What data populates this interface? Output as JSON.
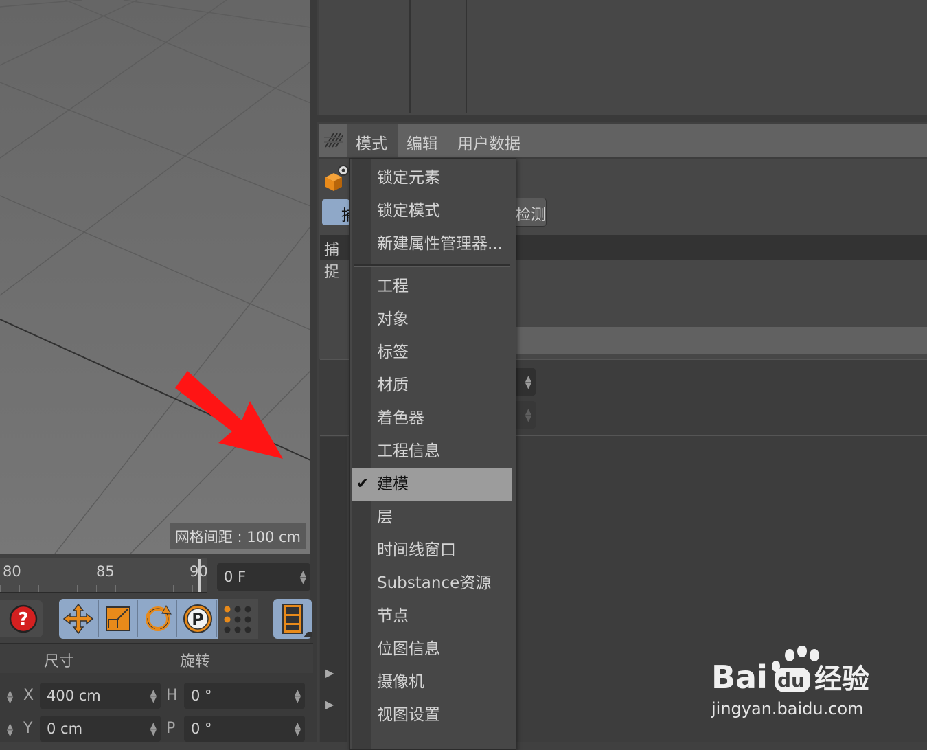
{
  "viewport": {
    "grid_label": "网格间距 : 100 cm"
  },
  "timeline": {
    "ticks": [
      "80",
      "85",
      "90"
    ],
    "frame_value": "0 F"
  },
  "coordinates": {
    "col_size": "尺寸",
    "col_rotation": "旋转",
    "rows": [
      {
        "axis": "X",
        "size": "400 cm",
        "rot_axis": "H",
        "rot": "0 °"
      },
      {
        "axis": "Y",
        "size": "0 cm",
        "rot_axis": "P",
        "rot": "0 °"
      }
    ]
  },
  "attribute_manager": {
    "menu": [
      "模式",
      "编辑",
      "用户数据"
    ],
    "partial_tab": "捕",
    "partial_label": "捕捉",
    "partial_button": "检测"
  },
  "dropdown": {
    "items_top": [
      "锁定元素",
      "锁定模式",
      "新建属性管理器..."
    ],
    "items": [
      "工程",
      "对象",
      "标签",
      "材质",
      "着色器",
      "工程信息",
      "建模",
      "层",
      "时间线窗口",
      "Substance资源",
      "节点",
      "位图信息",
      "摄像机",
      "视图设置"
    ],
    "selected": "建模",
    "check_mark": "✔"
  },
  "watermark": {
    "logo_text": "Bai",
    "logo_du": "du",
    "logo_cn": "经验",
    "url": "jingyan.baidu.com"
  },
  "colors": {
    "accent_blue": "#8fa8c8",
    "icon_orange": "#e88a1a",
    "arrow_red": "#ff1414"
  }
}
